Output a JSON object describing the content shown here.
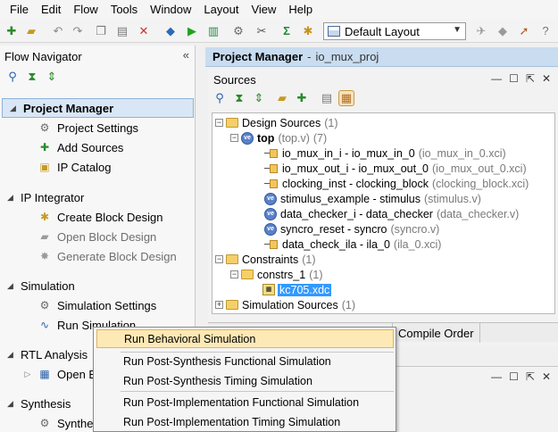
{
  "menubar": {
    "items": [
      "File",
      "Edit",
      "Flow",
      "Tools",
      "Window",
      "Layout",
      "View",
      "Help"
    ]
  },
  "toolbar": {
    "layout_value": "Default Layout"
  },
  "flow_navigator": {
    "title": "Flow Navigator",
    "collapse_glyph": "«",
    "sections": [
      {
        "title": "Project Manager",
        "items": [
          "Project Settings",
          "Add Sources",
          "IP Catalog"
        ]
      },
      {
        "title": "IP Integrator",
        "items": [
          "Create Block Design",
          "Open Block Design",
          "Generate Block Design"
        ]
      },
      {
        "title": "Simulation",
        "items": [
          "Simulation Settings",
          "Run Simulation"
        ]
      },
      {
        "title": "RTL Analysis",
        "items": [
          "Open E"
        ]
      },
      {
        "title": "Synthesis",
        "items": [
          "Synthe"
        ]
      }
    ]
  },
  "project_header": {
    "title": "Project Manager",
    "separator": "-",
    "project": "io_mux_proj"
  },
  "sources": {
    "title": "Sources",
    "tree": {
      "design_sources": {
        "label": "Design Sources",
        "count": "(1)"
      },
      "top": {
        "label": "top",
        "file": "(top.v)",
        "count": "(7)"
      },
      "children": [
        {
          "label": "io_mux_in_i - io_mux_in_0",
          "file": "(io_mux_in_0.xci)"
        },
        {
          "label": "io_mux_out_i - io_mux_out_0",
          "file": "(io_mux_out_0.xci)"
        },
        {
          "label": "clocking_inst - clocking_block",
          "file": "(clocking_block.xci)"
        },
        {
          "label": "stimulus_example - stimulus",
          "file": "(stimulus.v)"
        },
        {
          "label": "data_checker_i - data_checker",
          "file": "(data_checker.v)"
        },
        {
          "label": "syncro_reset - syncro",
          "file": "(syncro.v)"
        },
        {
          "label": "data_check_ila - ila_0",
          "file": "(ila_0.xci)"
        }
      ],
      "constraints": {
        "label": "Constraints",
        "count": "(1)"
      },
      "constrs_1": {
        "label": "constrs_1",
        "count": "(1)"
      },
      "xdc": {
        "label": "kc705.xdc"
      },
      "simulation_sources": {
        "label": "Simulation Sources",
        "count": "(1)"
      }
    },
    "bottom_tabs": [
      "Compile Order"
    ]
  },
  "context_menu": {
    "items": [
      "Run Behavioral Simulation",
      "Run Post-Synthesis Functional Simulation",
      "Run Post-Synthesis Timing Simulation",
      "Run Post-Implementation Functional Simulation",
      "Run Post-Implementation Timing Simulation"
    ]
  },
  "colors": {
    "accent": "#3399ff",
    "header_bg": "#c9dcf0",
    "highlight": "#fde9b6"
  }
}
